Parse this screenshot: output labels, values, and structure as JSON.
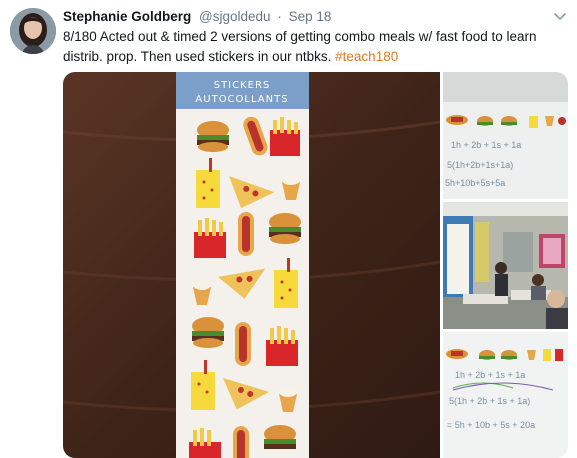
{
  "tweet": {
    "display_name": "Stephanie Goldberg",
    "handle": "@sjgoldedu",
    "separator": "·",
    "date": "Sep 18",
    "text_prefix": "8/180 Acted out & timed 2 versions of getting combo meals w/ fast food to learn distrib. prop. Then used stickers in our ntbks.",
    "hashtag": "#teach180"
  },
  "media": {
    "sticker_header_line1": "STICKERS",
    "sticker_header_line2": "AUTOCOLLANTS",
    "whiteboard_top_line1": "1h + 2b + 1s + 1a",
    "whiteboard_top_line2": "5(1h+2b+1s+1a)",
    "whiteboard_top_line3": "5h+10b+5s+5a",
    "whiteboard_bot_line1": "1h + 2b + 1s + 1a",
    "whiteboard_bot_line2": "5(1h + 2b + 1s + 1a)",
    "whiteboard_bot_line3": "= 5h + 10b + 5s + 20a"
  },
  "colors": {
    "hashtag": "#e07a1f",
    "handle": "#657786",
    "wood": "#4a2a1c",
    "sticker_header": "#7b9fc9"
  }
}
